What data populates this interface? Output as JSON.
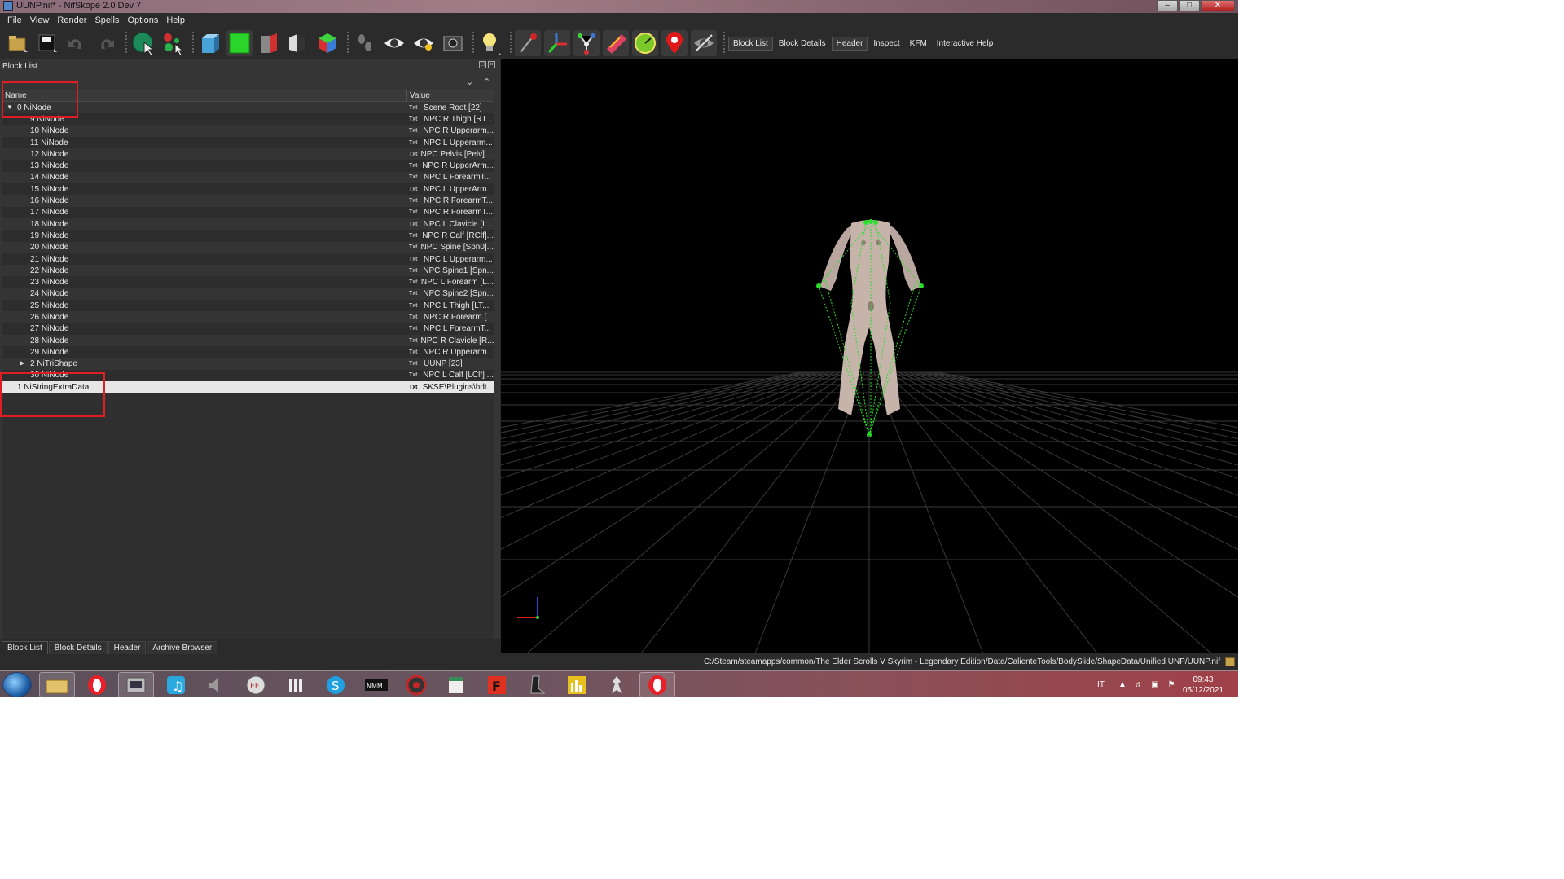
{
  "window": {
    "title": "UUNP.nif* - NifSkope 2.0 Dev 7"
  },
  "menu": [
    "File",
    "View",
    "Render",
    "Spells",
    "Options",
    "Help"
  ],
  "toolbar": {
    "text_buttons": [
      {
        "label": "Block List",
        "checked": true
      },
      {
        "label": "Block Details",
        "checked": false
      },
      {
        "label": "Header",
        "checked": true
      },
      {
        "label": "Inspect",
        "checked": false
      },
      {
        "label": "KFM",
        "checked": false
      },
      {
        "label": "Interactive Help",
        "checked": false
      }
    ]
  },
  "blocklist": {
    "title": "Block List",
    "columns": {
      "name": "Name",
      "value": "Value"
    },
    "rows": [
      {
        "name": "0 NiNode",
        "value": "Scene Root [22]",
        "indent": 1,
        "arrow": "expanded"
      },
      {
        "name": "9 NiNode",
        "value": "NPC R Thigh [RT...",
        "indent": 3
      },
      {
        "name": "10 NiNode",
        "value": "NPC R Upperarm...",
        "indent": 3
      },
      {
        "name": "11 NiNode",
        "value": "NPC L Upperarm...",
        "indent": 3
      },
      {
        "name": "12 NiNode",
        "value": "NPC Pelvis [Pelv] ...",
        "indent": 3
      },
      {
        "name": "13 NiNode",
        "value": "NPC R UpperArm...",
        "indent": 3
      },
      {
        "name": "14 NiNode",
        "value": "NPC L ForearmT...",
        "indent": 3
      },
      {
        "name": "15 NiNode",
        "value": "NPC L UpperArm...",
        "indent": 3
      },
      {
        "name": "16 NiNode",
        "value": "NPC R ForearmT...",
        "indent": 3
      },
      {
        "name": "17 NiNode",
        "value": "NPC R ForearmT...",
        "indent": 3
      },
      {
        "name": "18 NiNode",
        "value": "NPC L Clavicle [L...",
        "indent": 3
      },
      {
        "name": "19 NiNode",
        "value": "NPC R Calf [RClf]...",
        "indent": 3
      },
      {
        "name": "20 NiNode",
        "value": "NPC Spine [Spn0]...",
        "indent": 3
      },
      {
        "name": "21 NiNode",
        "value": "NPC L Upperarm...",
        "indent": 3
      },
      {
        "name": "22 NiNode",
        "value": "NPC Spine1 [Spn...",
        "indent": 3
      },
      {
        "name": "23 NiNode",
        "value": "NPC L Forearm [L...",
        "indent": 3
      },
      {
        "name": "24 NiNode",
        "value": "NPC Spine2 [Spn...",
        "indent": 3
      },
      {
        "name": "25 NiNode",
        "value": "NPC L Thigh [LT...",
        "indent": 3
      },
      {
        "name": "26 NiNode",
        "value": "NPC R Forearm [...",
        "indent": 3
      },
      {
        "name": "27 NiNode",
        "value": "NPC L ForearmT...",
        "indent": 3
      },
      {
        "name": "28 NiNode",
        "value": "NPC R Clavicle [R...",
        "indent": 3
      },
      {
        "name": "29 NiNode",
        "value": "NPC R Upperarm...",
        "indent": 3
      },
      {
        "name": "2 NiTriShape",
        "value": "UUNP [23]",
        "indent": 2,
        "arrow": "collapsed"
      },
      {
        "name": "30 NiNode",
        "value": "NPC L Calf [LClf] ...",
        "indent": 3
      },
      {
        "name": "1 NiStringExtraData",
        "value": "SKSE\\Plugins\\hdt...",
        "indent": 1,
        "selected": true
      }
    ],
    "value_icon_label": "Txt",
    "tabs": [
      "Block List",
      "Block Details",
      "Header",
      "Archive Browser"
    ]
  },
  "status": {
    "path": "C:/Steam/steamapps/common/The Elder Scrolls V Skyrim - Legendary Edition/Data/CalienteTools/BodySlide/ShapeData/Unified UNP/UUNP.nif"
  },
  "taskbar": {
    "apps": [
      "windows-explorer",
      "opera",
      "media-center",
      "itunes",
      "audio",
      "ffdec",
      "jdownloader",
      "skype",
      "nmm",
      "game-launcher",
      "notepad",
      "foobar",
      "mod-tool",
      "bar-chart",
      "skyrim",
      "opera-active"
    ],
    "lang": "IT",
    "time": "09:43",
    "date": "05/12/2021"
  },
  "colors": {
    "highlight": "#e11d24",
    "viewport_bg": "#000000",
    "skeleton": "#28e028",
    "grid": "#3a3a3a"
  }
}
